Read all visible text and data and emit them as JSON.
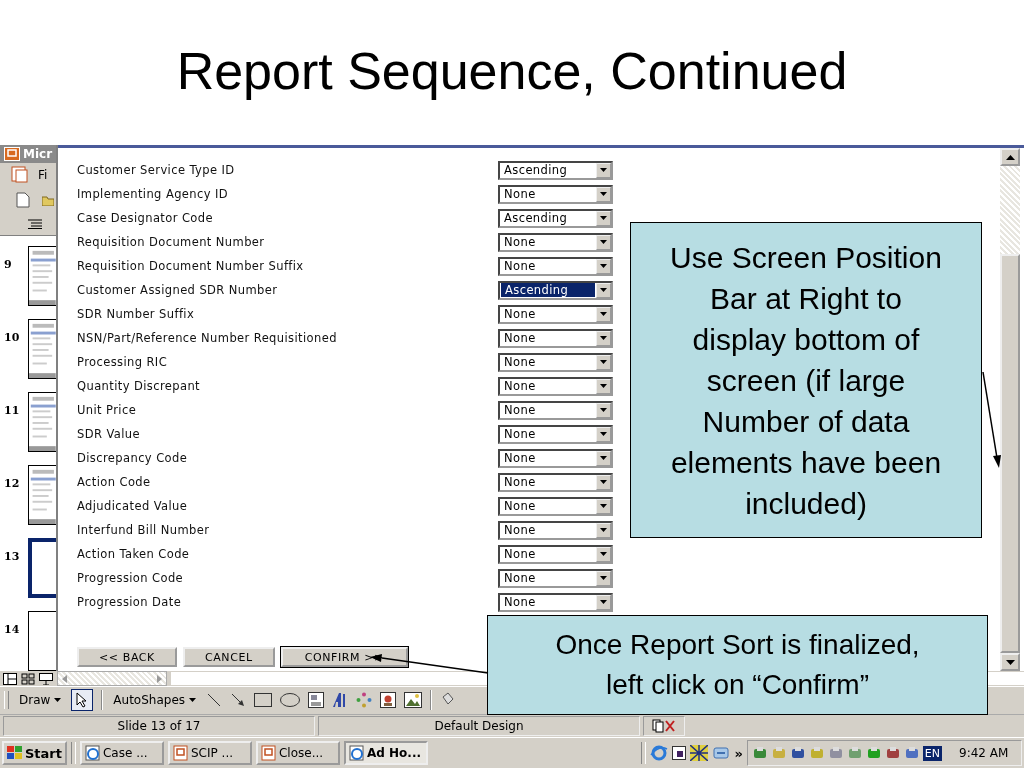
{
  "slide_title": "Report Sequence, Continued",
  "app": {
    "title": "Micr",
    "menu": "Fi"
  },
  "slides": [
    {
      "number": "9",
      "selected": false
    },
    {
      "number": "10",
      "selected": false
    },
    {
      "number": "11",
      "selected": false
    },
    {
      "number": "12",
      "selected": false
    },
    {
      "number": "13",
      "selected": true
    },
    {
      "number": "14",
      "selected": false
    }
  ],
  "form": {
    "rows": [
      {
        "label": "Customer Service Type ID",
        "value": "Ascending",
        "selected": false
      },
      {
        "label": "Implementing Agency ID",
        "value": "None",
        "selected": false
      },
      {
        "label": "Case Designator Code",
        "value": "Ascending",
        "selected": false
      },
      {
        "label": "Requisition Document Number",
        "value": "None",
        "selected": false
      },
      {
        "label": "Requisition Document Number Suffix",
        "value": "None",
        "selected": false
      },
      {
        "label": "Customer Assigned SDR Number",
        "value": "Ascending",
        "selected": true
      },
      {
        "label": "SDR Number Suffix",
        "value": "None",
        "selected": false
      },
      {
        "label": "NSN/Part/Reference Number Requisitioned",
        "value": "None",
        "selected": false
      },
      {
        "label": "Processing RIC",
        "value": "None",
        "selected": false
      },
      {
        "label": "Quantity Discrepant",
        "value": "None",
        "selected": false
      },
      {
        "label": "Unit Price",
        "value": "None",
        "selected": false
      },
      {
        "label": "SDR Value",
        "value": "None",
        "selected": false
      },
      {
        "label": "Discrepancy Code",
        "value": "None",
        "selected": false
      },
      {
        "label": "Action Code",
        "value": "None",
        "selected": false
      },
      {
        "label": "Adjudicated Value",
        "value": "None",
        "selected": false
      },
      {
        "label": "Interfund Bill Number",
        "value": "None",
        "selected": false
      },
      {
        "label": "Action Taken Code",
        "value": "None",
        "selected": false
      },
      {
        "label": "Progression Code",
        "value": "None",
        "selected": false
      },
      {
        "label": "Progression Date",
        "value": "None",
        "selected": false
      }
    ],
    "buttons": [
      "<< BACK",
      "CANCEL",
      "CONFIRM >>"
    ]
  },
  "draw_toolbar": {
    "draw": "Draw",
    "autoshapes": "AutoShapes"
  },
  "status_bar": {
    "slide": "Slide 13 of 17",
    "design": "Default Design"
  },
  "taskbar": {
    "start": "Start",
    "tasks": [
      {
        "label": "Case ...",
        "kind": "browser",
        "selected": false
      },
      {
        "label": "SCIP ...",
        "kind": "presentation",
        "selected": false
      },
      {
        "label": "Close...",
        "kind": "presentation",
        "selected": false
      },
      {
        "label": "Ad Ho...",
        "kind": "browser",
        "selected": true
      }
    ],
    "more": "»",
    "language": "EN",
    "clock": "9:42 AM"
  },
  "callouts": [
    {
      "text": "Use Screen Position Bar at Right to display bottom of screen (if large Number of data elements have been included)"
    },
    {
      "text": "Once Report Sort is finalized, left click on “Confirm”"
    }
  ]
}
